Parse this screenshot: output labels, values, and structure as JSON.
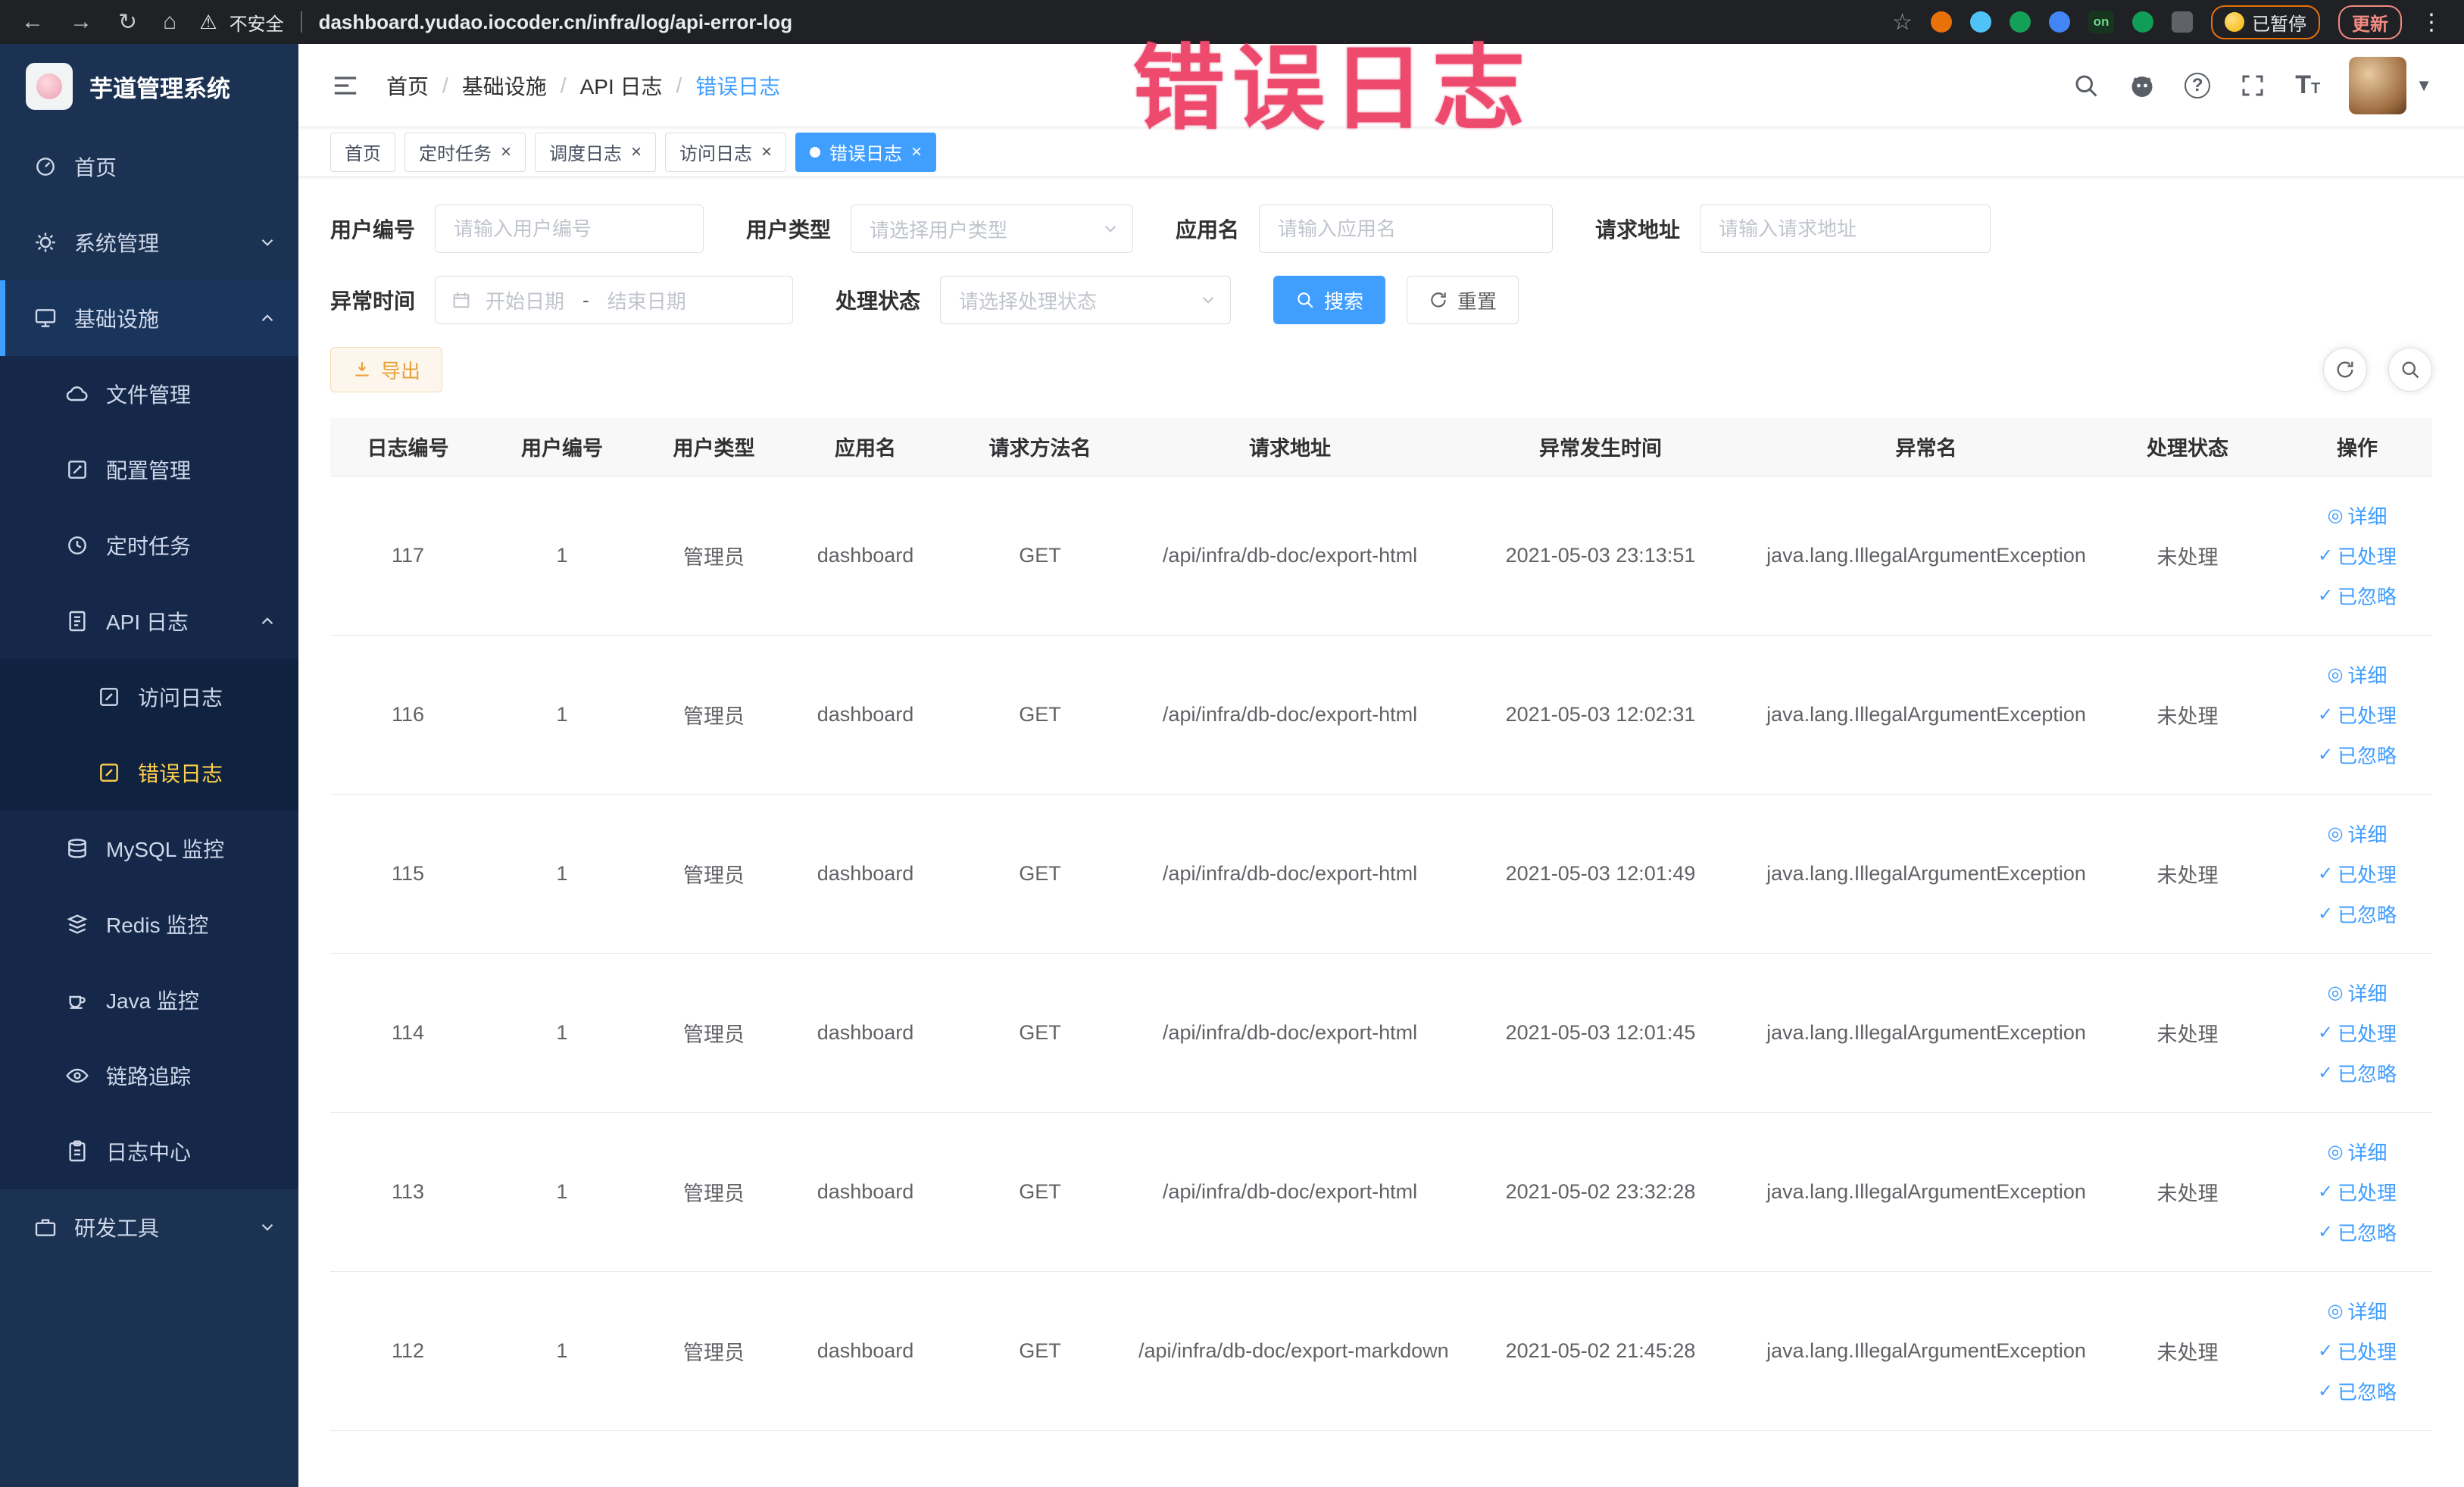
{
  "browser": {
    "security_warning": "不安全",
    "url": "dashboard.yudao.iocoder.cn/infra/log/api-error-log",
    "on_badge": "on",
    "paused_badge": "已暂停",
    "update_button": "更新"
  },
  "annotation": {
    "text": "错误日志"
  },
  "sidebar": {
    "title": "芋道管理系统",
    "items": {
      "home": "首页",
      "system": "系统管理",
      "infra": "基础设施",
      "file": "文件管理",
      "config": "配置管理",
      "job": "定时任务",
      "apilog": "API 日志",
      "accesslog": "访问日志",
      "errorlog": "错误日志",
      "mysql": "MySQL 监控",
      "redis": "Redis 监控",
      "java": "Java 监控",
      "trace": "链路追踪",
      "logcenter": "日志中心",
      "devtools": "研发工具"
    }
  },
  "navbar": {
    "breadcrumb": [
      "首页",
      "基础设施",
      "API 日志",
      "错误日志"
    ]
  },
  "tabs": [
    {
      "label": "首页"
    },
    {
      "label": "定时任务"
    },
    {
      "label": "调度日志"
    },
    {
      "label": "访问日志"
    },
    {
      "label": "错误日志"
    }
  ],
  "filters": {
    "user_id_label": "用户编号",
    "user_id_placeholder": "请输入用户编号",
    "user_type_label": "用户类型",
    "user_type_placeholder": "请选择用户类型",
    "app_label": "应用名",
    "app_placeholder": "请输入应用名",
    "url_label": "请求地址",
    "url_placeholder": "请输入请求地址",
    "time_label": "异常时间",
    "time_start_placeholder": "开始日期",
    "time_separator": "-",
    "time_end_placeholder": "结束日期",
    "status_label": "处理状态",
    "status_placeholder": "请选择处理状态",
    "search": "搜索",
    "reset": "重置"
  },
  "toolbar": {
    "export": "导出"
  },
  "table": {
    "columns": [
      "日志编号",
      "用户编号",
      "用户类型",
      "应用名",
      "请求方法名",
      "请求地址",
      "异常发生时间",
      "异常名",
      "处理状态",
      "操作"
    ],
    "actions": {
      "view": "详细",
      "done": "已处理",
      "ignore": "已忽略"
    },
    "rows": [
      {
        "id": "117",
        "user": "1",
        "type": "管理员",
        "app": "dashboard",
        "method": "GET",
        "url": "/api/infra/db-doc/export-html",
        "time": "2021-05-03 23:13:51",
        "exception": "java.lang.IllegalArgumentException",
        "status": "未处理"
      },
      {
        "id": "116",
        "user": "1",
        "type": "管理员",
        "app": "dashboard",
        "method": "GET",
        "url": "/api/infra/db-doc/export-html",
        "time": "2021-05-03 12:02:31",
        "exception": "java.lang.IllegalArgumentException",
        "status": "未处理"
      },
      {
        "id": "115",
        "user": "1",
        "type": "管理员",
        "app": "dashboard",
        "method": "GET",
        "url": "/api/infra/db-doc/export-html",
        "time": "2021-05-03 12:01:49",
        "exception": "java.lang.IllegalArgumentException",
        "status": "未处理"
      },
      {
        "id": "114",
        "user": "1",
        "type": "管理员",
        "app": "dashboard",
        "method": "GET",
        "url": "/api/infra/db-doc/export-html",
        "time": "2021-05-03 12:01:45",
        "exception": "java.lang.IllegalArgumentException",
        "status": "未处理"
      },
      {
        "id": "113",
        "user": "1",
        "type": "管理员",
        "app": "dashboard",
        "method": "GET",
        "url": "/api/infra/db-doc/export-html",
        "time": "2021-05-02 23:32:28",
        "exception": "java.lang.IllegalArgumentException",
        "status": "未处理"
      },
      {
        "id": "112",
        "user": "1",
        "type": "管理员",
        "app": "dashboard",
        "method": "GET",
        "url": "/api/infra/db-doc/export-markdown",
        "time": "2021-05-02 21:45:28",
        "exception": "java.lang.IllegalArgumentException",
        "status": "未处理"
      }
    ]
  }
}
